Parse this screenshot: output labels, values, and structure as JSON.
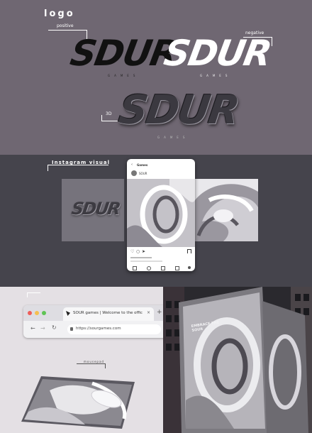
{
  "logo_section": {
    "title": "logo",
    "positive_label": "positive",
    "negative_label": "negative",
    "label_3d": "3D",
    "wordmark": "SDUR",
    "subtext": "GAMES"
  },
  "instagram_section": {
    "title": "Instagram visual",
    "app_header": "Games",
    "post_account": "SOUR"
  },
  "browser": {
    "tab_title": "SOUR games | Welcome to the offic",
    "url": "https://sourgames.com",
    "new_tab": "+",
    "close_tab": "×"
  },
  "mousepad_label": "mousepad",
  "billboard_text": "EMBRACE THE SOUR",
  "colors": {
    "logo_bg": "#6f6772",
    "insta_bg": "#45444c",
    "browser_red": "#ee5d5a",
    "browser_yellow": "#f5bf4f",
    "browser_green": "#5fc454"
  }
}
